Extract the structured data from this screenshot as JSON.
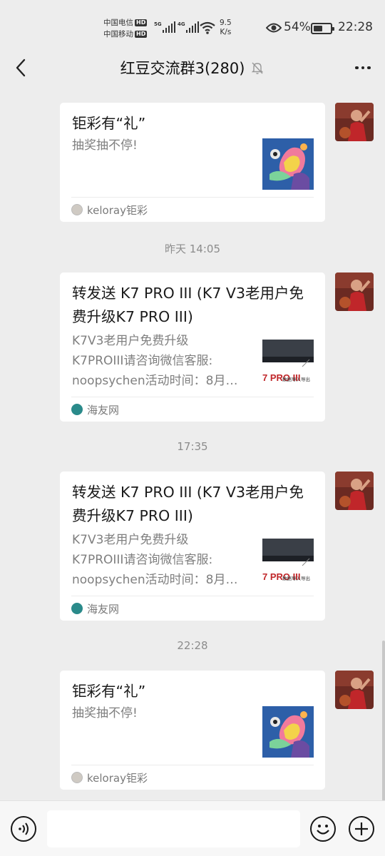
{
  "status": {
    "carrier1": "中国电信",
    "carrier2": "中国移动",
    "hd": "HD",
    "sig1_tag": "5G",
    "sig2_tag": "4G",
    "speed_value": "9.5",
    "speed_unit": "K/s",
    "battery": "54%",
    "battery_level": 0.54,
    "time": "22:28"
  },
  "header": {
    "title": "红豆交流群3(280)",
    "back_icon": "chevron-left-icon",
    "mute_icon": "bell-off-icon",
    "more_icon": "more-dots-icon"
  },
  "messages": [
    {
      "type": "link_card",
      "title": "钜彩有“礼”",
      "desc": [
        "抽奖抽不停!"
      ],
      "source": "keloray钜彩",
      "thumb": "abstract-sea-art"
    },
    {
      "type": "time",
      "text": "昨天 14:05"
    },
    {
      "type": "link_card",
      "title": "转发送 K7 PRO III (K7 V3老用户免费升级K7 PRO III)",
      "desc": [
        "K7V3老用户免费升级",
        "K7PROIII请咨询微信客服:",
        "noopsychen活动时间：8月…"
      ],
      "source": "海友网",
      "thumb": "device-banner",
      "thumb_text": "7 PRO III",
      "thumb_sub": "数据导入导出"
    },
    {
      "type": "time",
      "text": "17:35"
    },
    {
      "type": "link_card",
      "title": "转发送 K7 PRO III (K7 V3老用户免费升级K7 PRO III)",
      "desc": [
        "K7V3老用户免费升级",
        "K7PROIII请咨询微信客服:",
        "noopsychen活动时间：8月…"
      ],
      "source": "海友网",
      "thumb": "device-banner",
      "thumb_text": "7 PRO III",
      "thumb_sub": "数据导入导出"
    },
    {
      "type": "time",
      "text": "22:28"
    },
    {
      "type": "link_card",
      "title": "钜彩有“礼”",
      "desc": [
        "抽奖抽不停!"
      ],
      "source": "keloray钜彩",
      "thumb": "abstract-sea-art"
    }
  ],
  "input": {
    "voice_icon": "voice-icon",
    "emoji_icon": "emoji-icon",
    "plus_icon": "plus-icon",
    "placeholder": ""
  },
  "colors": {
    "background": "#ededed",
    "card": "#ffffff",
    "title_text": "#1a1a1a",
    "desc_text": "#7f7f7f",
    "time_text": "#8c8c8c"
  }
}
